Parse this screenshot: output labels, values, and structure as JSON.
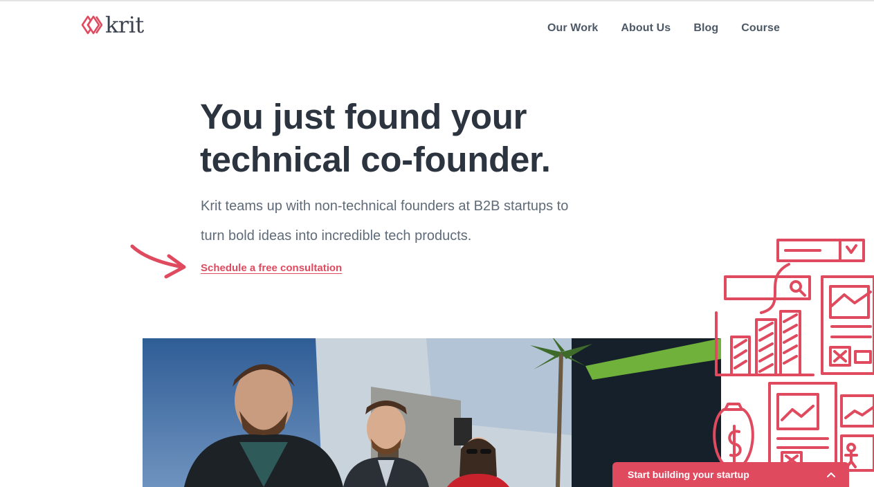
{
  "brand": {
    "name": "krit",
    "accent": "#e04a5f"
  },
  "nav": {
    "items": [
      "Our Work",
      "About Us",
      "Blog",
      "Course"
    ]
  },
  "hero": {
    "title_line1": "You just found your",
    "title_line2": "technical co-founder.",
    "lead_line1": "Krit teams up with non-technical founders at B2B startups to",
    "lead_line2": "turn bold ideas into incredible tech products.",
    "cta": "Schedule a free consultation"
  },
  "chat": {
    "label": "Start building your startup",
    "icon": "chevron-up-icon"
  },
  "icons": [
    "krit-logo-icon",
    "hand-drawn-arrow-icon",
    "wireframe-doodles-illustration"
  ]
}
